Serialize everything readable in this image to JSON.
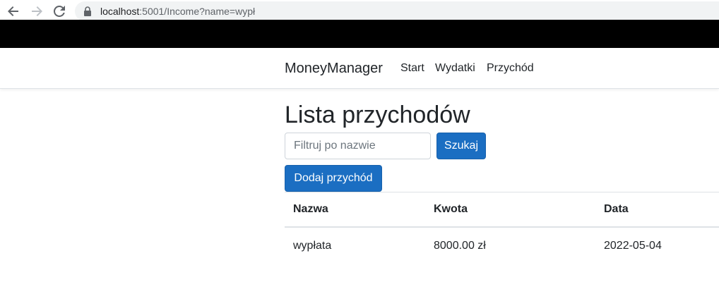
{
  "browser": {
    "url_host": "localhost",
    "url_path": ":5001/Income?name=wypł"
  },
  "navbar": {
    "brand": "MoneyManager",
    "links": [
      {
        "label": "Start"
      },
      {
        "label": "Wydatki"
      },
      {
        "label": "Przychód"
      }
    ]
  },
  "main": {
    "title": "Lista przychodów",
    "search": {
      "placeholder": "Filtruj po nazwie",
      "value": "",
      "button_label": "Szukaj"
    },
    "add_button_label": "Dodaj przychód",
    "table": {
      "headers": [
        "Nazwa",
        "Kwota",
        "Data"
      ],
      "rows": [
        [
          "wypłata",
          "8000.00 zł",
          "2022-05-04"
        ]
      ]
    }
  },
  "colors": {
    "primary": "#1b6ec2",
    "band": "#000000"
  },
  "icons": [
    "back-arrow-icon",
    "forward-arrow-icon",
    "reload-icon",
    "lock-icon"
  ]
}
